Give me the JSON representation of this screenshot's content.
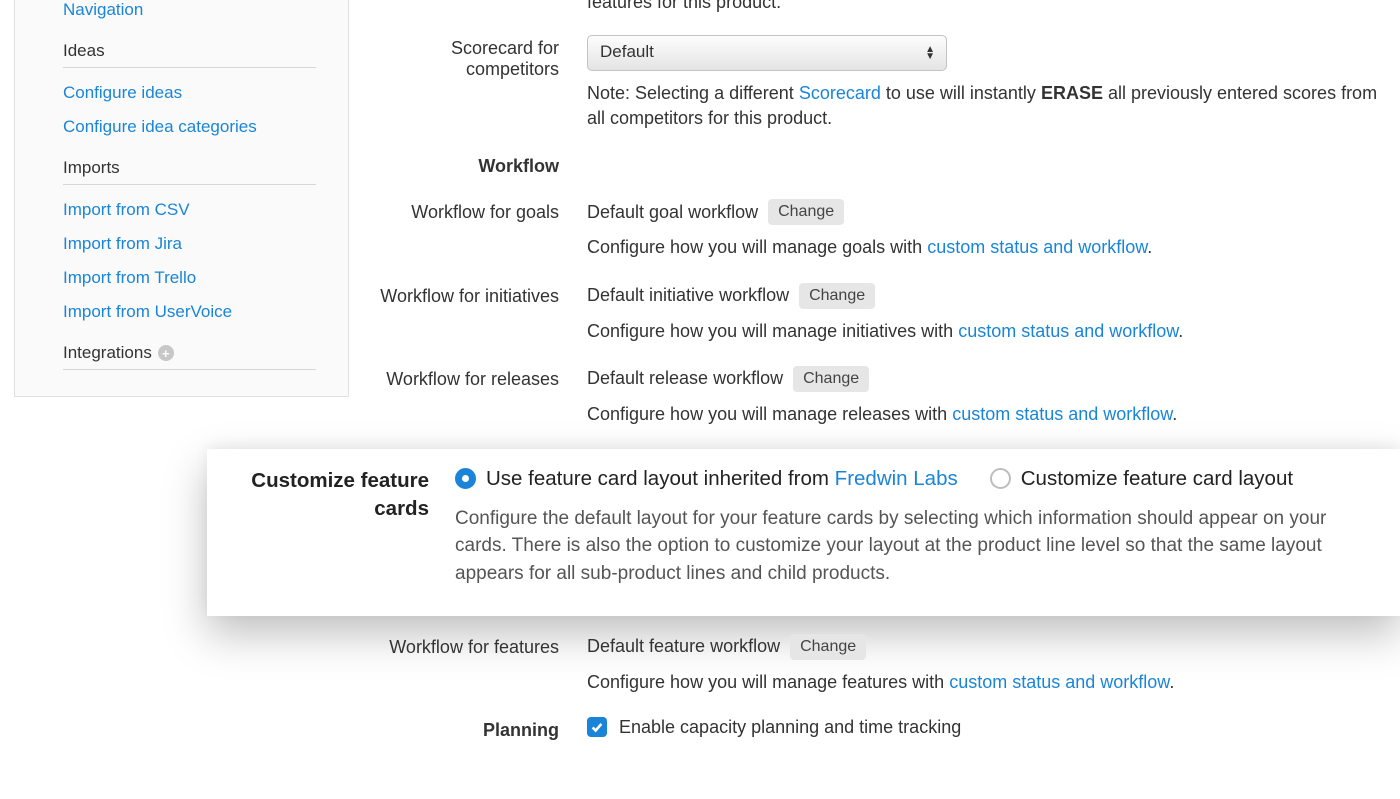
{
  "sidebar": {
    "nav_link": "Navigation",
    "ideas_title": "Ideas",
    "ideas_links": [
      "Configure ideas",
      "Configure idea categories"
    ],
    "imports_title": "Imports",
    "imports_links": [
      "Import from CSV",
      "Import from Jira",
      "Import from Trello",
      "Import from UserVoice"
    ],
    "integrations_title": "Integrations"
  },
  "top_note": "features for this product.",
  "scorecard": {
    "label": "Scorecard for competitors",
    "selected": "Default",
    "note_prefix": "Note: Selecting a different ",
    "link": "Scorecard",
    "note_mid": " to use will instantly ",
    "erase": "ERASE",
    "note_suffix": " all previously entered scores from all competitors for this product."
  },
  "workflow_header": "Workflow",
  "workflows": {
    "goals": {
      "label": "Workflow for goals",
      "value": "Default goal workflow",
      "change": "Change",
      "desc_prefix": "Configure how you will manage goals with ",
      "link": "custom status and workflow",
      "desc_suffix": "."
    },
    "initiatives": {
      "label": "Workflow for initiatives",
      "value": "Default initiative workflow",
      "change": "Change",
      "desc_prefix": "Configure how you will manage initiatives with ",
      "link": "custom status and workflow",
      "desc_suffix": "."
    },
    "releases": {
      "label": "Workflow for releases",
      "value": "Default release workflow",
      "change": "Change",
      "desc_prefix": "Configure how you will manage releases with ",
      "link": "custom status and workflow",
      "desc_suffix": "."
    },
    "features": {
      "label": "Workflow for features",
      "value": "Default feature workflow",
      "change": "Change",
      "desc_prefix": "Configure how you will manage features with ",
      "link": "custom status and workflow",
      "desc_suffix": "."
    }
  },
  "feature_cards": {
    "label": "Customize feature cards",
    "opt1_prefix": "Use feature card layout inherited from ",
    "opt1_link": "Fredwin Labs",
    "opt2": "Customize feature card layout",
    "desc": "Configure the default layout for your feature cards by selecting which information should appear on your cards. There is also the option to customize your layout at the product line level so that the same layout appears for all sub-product lines and child products."
  },
  "planning": {
    "label": "Planning",
    "checkbox_label": "Enable capacity planning and time tracking"
  }
}
